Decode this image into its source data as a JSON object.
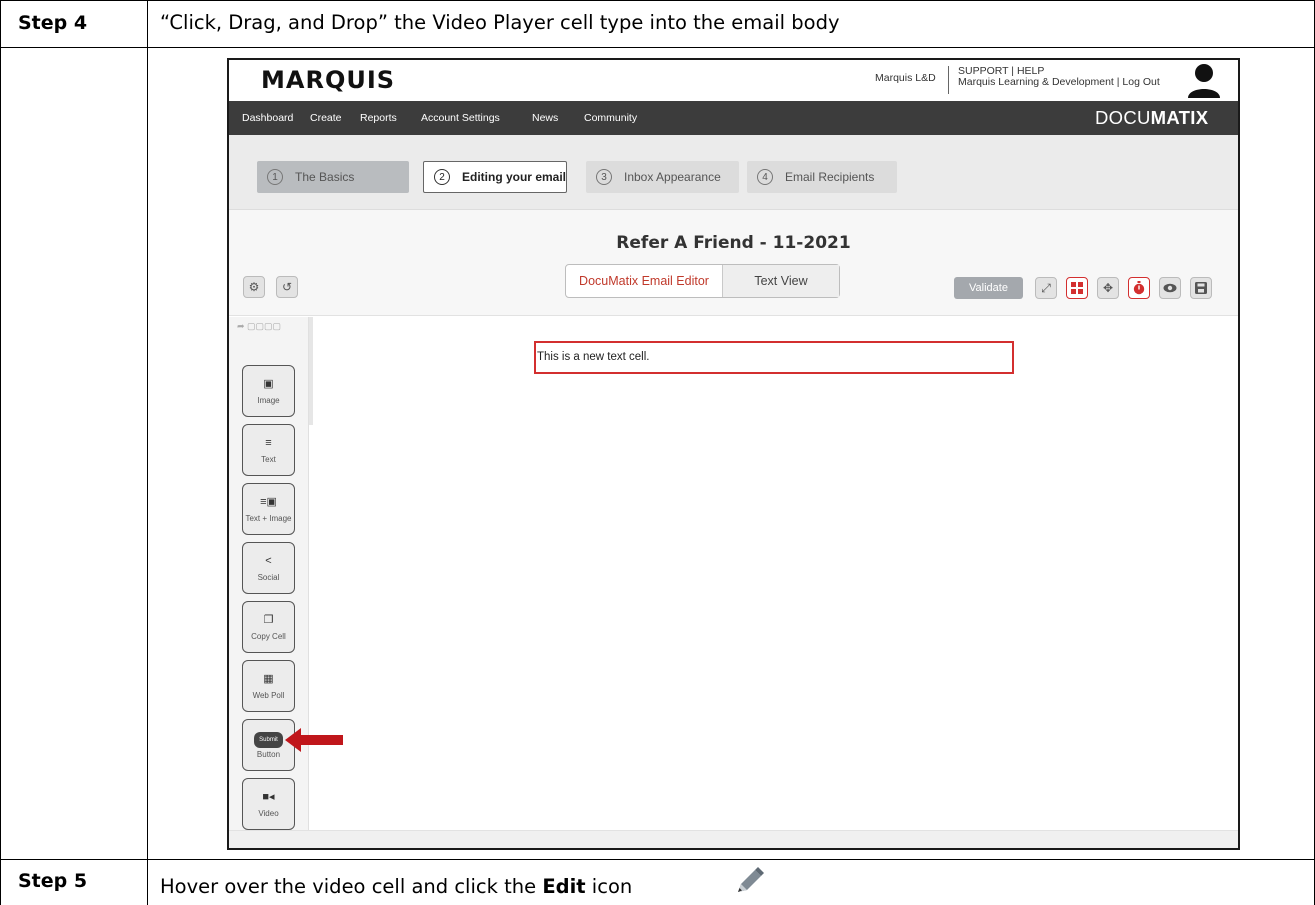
{
  "steps": [
    {
      "label": "Step 4",
      "text": "“Click, Drag, and Drop” the Video Player cell type into the email body"
    },
    {
      "label": "Step 5",
      "text_before": "Hover over the video cell and click the ",
      "text_bold": "Edit",
      "text_after": " icon"
    }
  ],
  "app": {
    "logo": "MARQUIS",
    "org_name": "Marquis L&D",
    "support_line1": "SUPPORT | HELP",
    "support_line2": "Marquis Learning & Development | Log Out",
    "brand_light": "DOCU",
    "brand_bold": "MATIX",
    "nav": [
      "Dashboard",
      "Create",
      "Reports",
      "Account Settings",
      "News",
      "Community"
    ],
    "wizard": [
      {
        "num": "1",
        "label": "The Basics",
        "state": "done"
      },
      {
        "num": "2",
        "label": "Editing your email",
        "state": "active"
      },
      {
        "num": "3",
        "label": "Inbox Appearance",
        "state": "idle"
      },
      {
        "num": "4",
        "label": "Email Recipients",
        "state": "idle"
      }
    ],
    "document_title": "Refer A Friend - 11-2021",
    "view_toggle": {
      "editor": "DocuMatix Email Editor",
      "text_view": "Text View"
    },
    "validate_label": "Validate",
    "palette": [
      {
        "label": "Image",
        "icon": "image-icon"
      },
      {
        "label": "Text",
        "icon": "text-lines-icon"
      },
      {
        "label": "Text + Image",
        "icon": "text-image-icon"
      },
      {
        "label": "Social",
        "icon": "share-icon"
      },
      {
        "label": "Copy Cell",
        "icon": "copy-icon"
      },
      {
        "label": "Web Poll",
        "icon": "poll-chart-icon"
      },
      {
        "label": "Button",
        "pill": "Submit",
        "icon": "submit-pill-icon"
      },
      {
        "label": "Video",
        "icon": "video-camera-icon"
      }
    ],
    "text_cell": "This is a new text cell."
  },
  "colors": {
    "nav_bg": "#3c3c3c",
    "accent_red": "#d32f2f",
    "arrow_red": "#c0161b",
    "wizard_bg": "#ebebeb"
  }
}
